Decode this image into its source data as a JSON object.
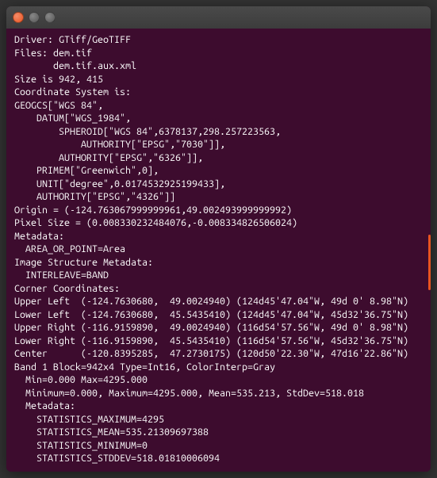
{
  "titlebar": {
    "title": ""
  },
  "terminal": {
    "lines": [
      "Driver: GTiff/GeoTIFF",
      "Files: dem.tif",
      "       dem.tif.aux.xml",
      "Size is 942, 415",
      "Coordinate System is:",
      "GEOGCS[\"WGS 84\",",
      "    DATUM[\"WGS_1984\",",
      "        SPHEROID[\"WGS 84\",6378137,298.257223563,",
      "            AUTHORITY[\"EPSG\",\"7030\"]],",
      "        AUTHORITY[\"EPSG\",\"6326\"]],",
      "    PRIMEM[\"Greenwich\",0],",
      "    UNIT[\"degree\",0.0174532925199433],",
      "    AUTHORITY[\"EPSG\",\"4326\"]]",
      "Origin = (-124.763067999999961,49.002493999999992)",
      "Pixel Size = (0.008330232484076,-0.008334826506024)",
      "Metadata:",
      "  AREA_OR_POINT=Area",
      "Image Structure Metadata:",
      "  INTERLEAVE=BAND",
      "Corner Coordinates:",
      "Upper Left  (-124.7630680,  49.0024940) (124d45'47.04\"W, 49d 0' 8.98\"N)",
      "Lower Left  (-124.7630680,  45.5435410) (124d45'47.04\"W, 45d32'36.75\"N)",
      "Upper Right (-116.9159890,  49.0024940) (116d54'57.56\"W, 49d 0' 8.98\"N)",
      "Lower Right (-116.9159890,  45.5435410) (116d54'57.56\"W, 45d32'36.75\"N)",
      "Center      (-120.8395285,  47.2730175) (120d50'22.30\"W, 47d16'22.86\"N)",
      "Band 1 Block=942x4 Type=Int16, ColorInterp=Gray",
      "  Min=0.000 Max=4295.000",
      "  Minimum=0.000, Maximum=4295.000, Mean=535.213, StdDev=518.018",
      "  Metadata:",
      "    STATISTICS_MAXIMUM=4295",
      "    STATISTICS_MEAN=535.21309697388",
      "    STATISTICS_MINIMUM=0",
      "    STATISTICS_STDDEV=518.01810006094"
    ]
  }
}
